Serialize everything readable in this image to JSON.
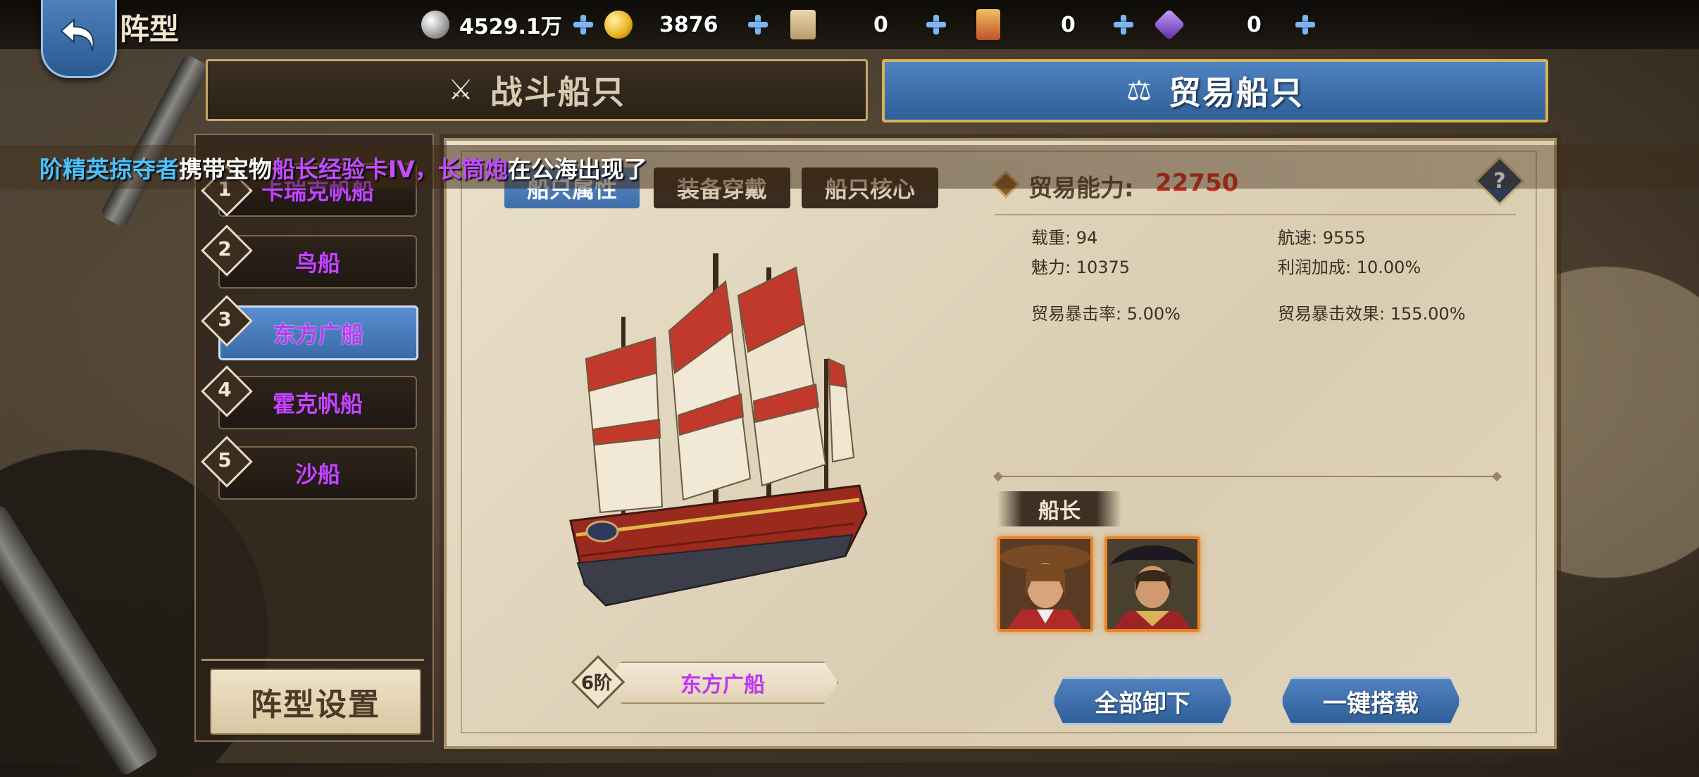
{
  "header": {
    "title": "阵型",
    "resources": [
      {
        "icon": "silver-coin-icon",
        "value": "4529.1万"
      },
      {
        "icon": "gold-coin-icon",
        "value": "3876"
      },
      {
        "icon": "scroll-icon",
        "value": "0"
      },
      {
        "icon": "card-icon",
        "value": "0"
      },
      {
        "icon": "gem-icon",
        "value": "0"
      }
    ]
  },
  "tabs": {
    "combat": "战斗船只",
    "trade": "贸易船只",
    "active": "trade"
  },
  "broadcast": {
    "part1": "阶精英掠夺者",
    "part2": "携带宝物",
    "part3": "船长经验卡IV，长筒炮",
    "part4": "在公海出现了"
  },
  "ship_list": [
    {
      "num": "1",
      "name": "卡瑞克帆船"
    },
    {
      "num": "2",
      "name": "鸟船"
    },
    {
      "num": "3",
      "name": "东方广船"
    },
    {
      "num": "4",
      "name": "霍克帆船"
    },
    {
      "num": "5",
      "name": "沙船"
    }
  ],
  "formation_button": "阵型设置",
  "subtabs": [
    "船只属性",
    "装备穿戴",
    "船只核心"
  ],
  "power": {
    "label": "贸易能力:",
    "value": "22750"
  },
  "stats": {
    "capacity": "载重: 94",
    "speed": "航速: 9555",
    "charm": "魅力: 10375",
    "profit_bonus": "利润加成: 10.00%",
    "crit_rate": "贸易暴击率: 5.00%",
    "crit_effect": "贸易暴击效果: 155.00%"
  },
  "ship": {
    "tier": "6阶",
    "name": "东方广船"
  },
  "captain_label": "船长",
  "buttons": {
    "unload_all": "全部卸下",
    "one_click": "一键搭载"
  },
  "colors": {
    "accent_blue": "#4f83c0",
    "rarity_purple": "#c035f5",
    "power_red": "#d12a1a",
    "captain_frame": "#e8862a"
  }
}
